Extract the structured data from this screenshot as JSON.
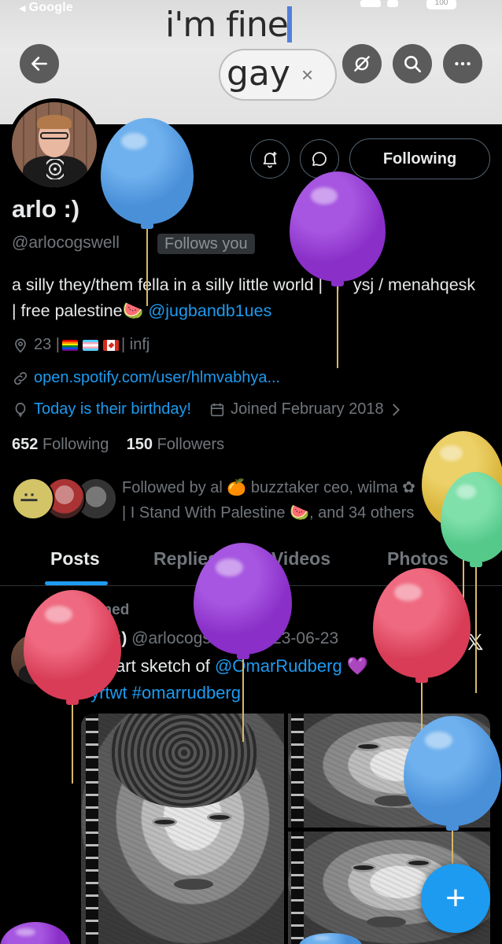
{
  "status": {
    "carrier": "Google",
    "battery": "100"
  },
  "banner": {
    "line1": "i'm fine",
    "line2": "gay",
    "close": "×"
  },
  "header": {
    "back_icon": "arrow-left-icon",
    "icons": [
      "eye-slash-icon",
      "search-icon",
      "more-icon"
    ]
  },
  "profile": {
    "display_name": "arlo :)",
    "handle": "@arlocogswell",
    "follows_you": "Follows you",
    "following_label": "Following",
    "bio_text": "a silly they/them fella in a silly little world | 📍 ysj / menahqesk | free palestine🍉 ",
    "bio_link": "@jugbandb1ues",
    "age": "23 |",
    "mbti": "| infj",
    "url": "open.spotify.com/user/hlmvabhya...",
    "birthday": "Today is their birthday!",
    "joined": "Joined February 2018",
    "following_count": "652",
    "following_word": "Following",
    "followers_count": "150",
    "followers_word": "Followers",
    "followed_by_line1": "Followed by al 🍊 buzztaker ceo, wilma ✿",
    "followed_by_line2": "| I Stand With Palestine 🍉, and 34 others"
  },
  "tabs": [
    "Posts",
    "Replies",
    "Videos",
    "Photos"
  ],
  "post": {
    "pinned_label": "Pinned",
    "name": "arlo :)",
    "meta": " @arlocogswell · 2023-06-23",
    "text_prefix": "Fan art sketch of ",
    "mention": "@OmarRudberg",
    "text_suffix": " 💜",
    "hashtags": "#yrtwt #omarrudberg",
    "x_logo": "𝕏"
  },
  "fab_label": "+",
  "colors": {
    "accent": "#1d9bf0",
    "muted": "#71767b",
    "text": "#e7e9ea",
    "background": "#000000"
  }
}
